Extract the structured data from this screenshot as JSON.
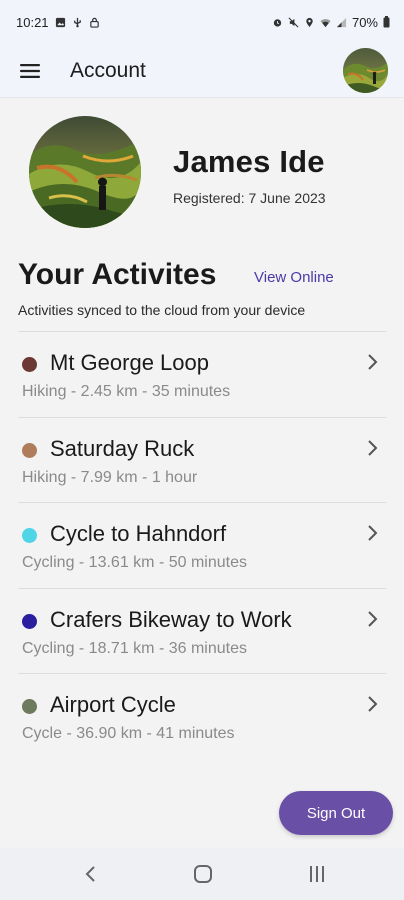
{
  "status_bar": {
    "time": "10:21",
    "battery": "70%",
    "icons_left": [
      "gallery-icon",
      "usb-icon",
      "lock-icon"
    ],
    "icons_right": [
      "alarm-icon",
      "mute-icon",
      "location-icon",
      "wifi-icon",
      "signal-icon",
      "battery-icon"
    ]
  },
  "app_bar": {
    "title": "Account",
    "menu_icon": "hamburger-menu-icon"
  },
  "profile": {
    "name": "James Ide",
    "registered": "Registered: 7 June 2023"
  },
  "activities_section": {
    "title": "Your Activites",
    "view_online_label": "View Online",
    "subtitle": "Activities synced to the cloud from your device",
    "items": [
      {
        "title": "Mt George Loop",
        "meta": "Hiking - 2.45 km - 35 minutes",
        "color": "#6b3833"
      },
      {
        "title": "Saturday Ruck",
        "meta": "Hiking - 7.99 km - 1 hour",
        "color": "#b07d5c"
      },
      {
        "title": "Cycle to Hahndorf",
        "meta": "Cycling - 13.61 km - 50 minutes",
        "color": "#4fd4e8"
      },
      {
        "title": "Crafers Bikeway to Work",
        "meta": "Cycling - 18.71 km - 36 minutes",
        "color": "#2a1f9e"
      },
      {
        "title": "Airport Cycle",
        "meta": "Cycle - 36.90 km - 41 minutes",
        "color": "#6e7a5e"
      }
    ]
  },
  "sign_out": {
    "label": "Sign Out"
  },
  "colors": {
    "accent": "#6a4fa6",
    "link": "#4a3aa7",
    "app_bar_bg": "#f1f4fb",
    "page_bg": "#f3f3f3"
  },
  "nav_bar": {
    "buttons": [
      "back-icon",
      "home-icon",
      "recents-icon"
    ]
  }
}
